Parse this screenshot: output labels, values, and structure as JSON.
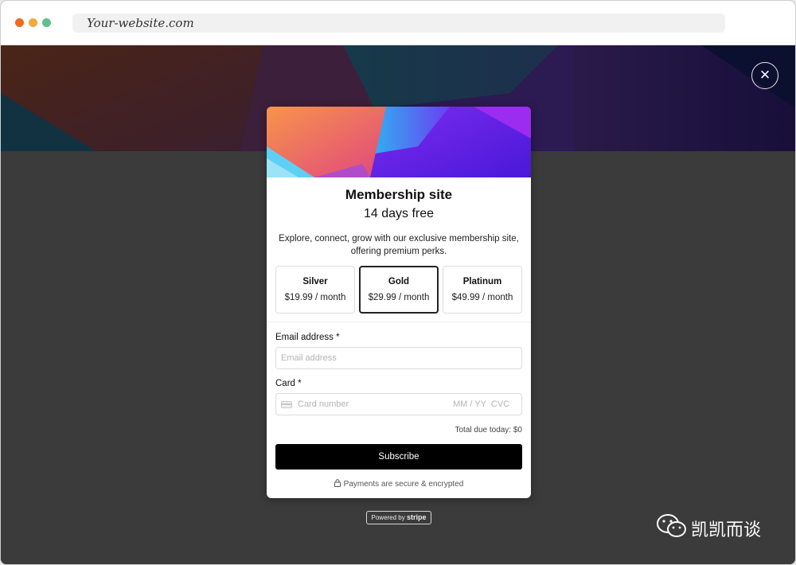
{
  "browser": {
    "url": "Your-website.com",
    "traffic_lights": [
      "#ee6b1c",
      "#f2a93b",
      "#5ec08c"
    ]
  },
  "overlay": {
    "close_icon": "close-icon",
    "close_glyph": "×"
  },
  "modal": {
    "title": "Membership site",
    "subtitle": "14 days free",
    "description": "Explore, connect, grow with our exclusive membership site, offering premium perks.",
    "plans": [
      {
        "name": "Silver",
        "price": "$19.99 / month",
        "selected": false
      },
      {
        "name": "Gold",
        "price": "$29.99 / month",
        "selected": true
      },
      {
        "name": "Platinum",
        "price": "$49.99 / month",
        "selected": false
      }
    ],
    "email": {
      "label": "Email address",
      "required_mark": "*",
      "placeholder": "Email address"
    },
    "card": {
      "label": "Card",
      "required_mark": "*",
      "number_placeholder": "Card number",
      "expiry_cvc_placeholder": "MM / YY  CVC",
      "icon": "credit-card-icon"
    },
    "total": "Total due today: $0",
    "subscribe_label": "Subscribe",
    "secure_note": "Payments are secure & encrypted",
    "secure_icon": "lock-icon"
  },
  "powered_by": {
    "prefix": "Powered by",
    "brand": "stripe"
  },
  "watermark": {
    "text": "凯凯而谈",
    "icon": "wechat-icon"
  },
  "colors": {
    "accent_button": "#000000",
    "backdrop": "#3b3b3b",
    "selected_border": "#222222"
  }
}
